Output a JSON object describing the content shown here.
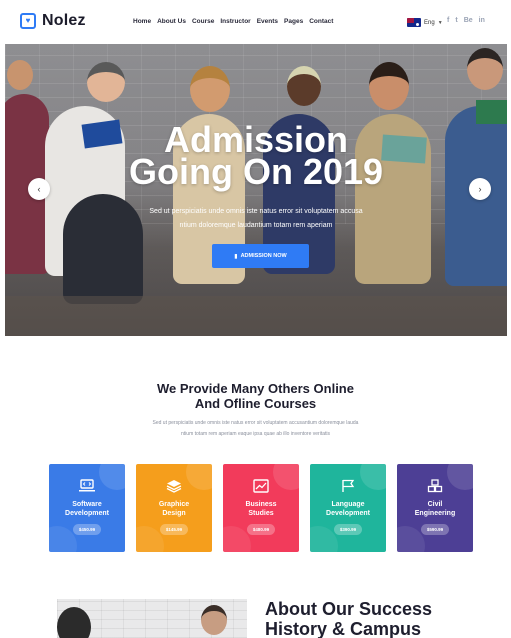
{
  "brand": {
    "name": "Nolez",
    "logo_icon": "heart-book-icon"
  },
  "nav": [
    "Home",
    "About Us",
    "Course",
    "Instructor",
    "Events",
    "Pages",
    "Contact"
  ],
  "language": {
    "label": "Eng",
    "flag_icon": "australia-flag-icon"
  },
  "social": [
    "f",
    "t",
    "Be",
    "in"
  ],
  "hero": {
    "title_line1": "Admission",
    "title_line2": "Going On 2019",
    "subtitle_line1": "Sed ut perspiciatis unde omnis iste natus error sit voluptatem accusa",
    "subtitle_line2": "ntium doloremque laudantium totam rem aperiam",
    "button_label": "ADMISSION NOW",
    "prev_icon": "chevron-left-icon",
    "next_icon": "chevron-right-icon"
  },
  "courses": {
    "title_line1": "We Provide Many Others Online",
    "title_line2": "And Ofline Courses",
    "desc_line1": "Sed ut perspiciatis unde omnis iste natus error sit voluptatem accusantium doloremque lauda",
    "desc_line2": "ntium totam rem aperiam eaque ipsa quae ab illo inventore veritatis",
    "items": [
      {
        "name_line1": "Software",
        "name_line2": "Development",
        "price": "$450.99",
        "icon": "laptop-code-icon",
        "color": "#3a7be7"
      },
      {
        "name_line1": "Graphice",
        "name_line2": "Design",
        "price": "$145.99",
        "icon": "layers-icon",
        "color": "#f59e1c"
      },
      {
        "name_line1": "Business",
        "name_line2": "Studies",
        "price": "$480.99",
        "icon": "chart-trend-icon",
        "color": "#f23b5b"
      },
      {
        "name_line1": "Language",
        "name_line2": "Development",
        "price": "$390.99",
        "icon": "flag-icon",
        "color": "#1fb59c"
      },
      {
        "name_line1": "Civil",
        "name_line2": "Engineering",
        "price": "$590.99",
        "icon": "cubes-icon",
        "color": "#4d3f95"
      }
    ]
  },
  "about": {
    "title_line1": "About Our Success",
    "title_line2": "History & Campus"
  }
}
